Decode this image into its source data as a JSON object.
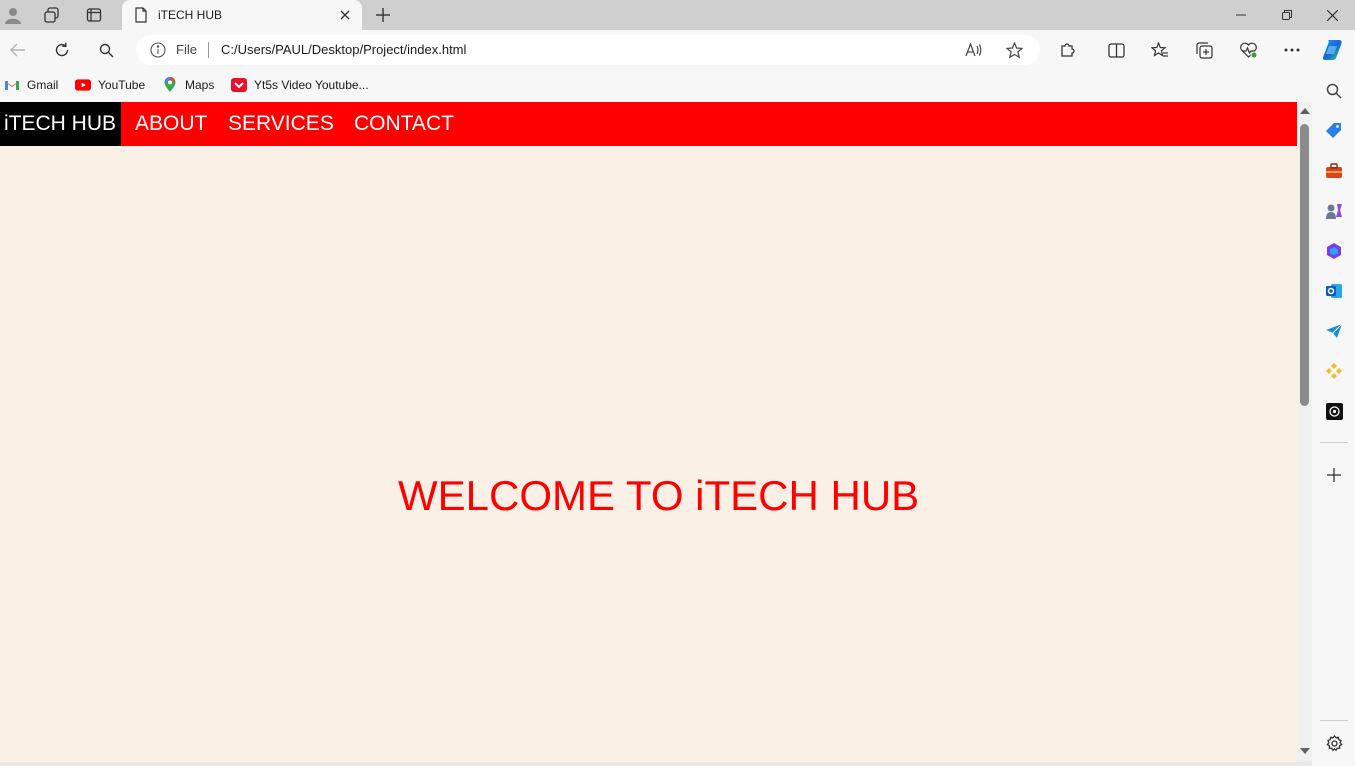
{
  "browser": {
    "tab_title": "iTECH HUB",
    "address": {
      "scheme_label": "File",
      "url": "C:/Users/PAUL/Desktop/Project/index.html"
    },
    "icons": {
      "profile": "profile-icon",
      "workspaces": "workspaces-icon",
      "tab_actions": "tab-actions-icon",
      "page": "page-icon",
      "close": "close-icon",
      "new_tab": "plus-icon",
      "minimize": "minimize-icon",
      "restore": "restore-icon",
      "window_close": "close-icon",
      "back": "back-arrow-icon",
      "refresh": "refresh-icon",
      "search": "search-icon",
      "info": "info-icon",
      "read_aloud": "read-aloud-icon",
      "favorite": "star-icon",
      "extensions": "puzzle-icon",
      "split_screen": "split-screen-icon",
      "favorites": "favorites-icon",
      "collections": "collections-icon",
      "browser_essentials": "heart-pulse-icon",
      "more": "more-icon",
      "copilot": "copilot-icon"
    },
    "bookmarks": [
      {
        "label": "Gmail",
        "icon": "gmail-icon"
      },
      {
        "label": "YouTube",
        "icon": "youtube-icon"
      },
      {
        "label": "Maps",
        "icon": "maps-pin-icon"
      },
      {
        "label": "Yt5s Video Youtube...",
        "icon": "yt5s-icon"
      }
    ],
    "sidebar_icons": [
      "search-icon",
      "tag-icon",
      "toolbox-icon",
      "games-icon",
      "office-icon",
      "outlook-icon",
      "send-icon",
      "binance-icon",
      "chatgpt-icon",
      "plus-icon",
      "settings-icon"
    ]
  },
  "site": {
    "colors": {
      "nav_bg": "#ff0000",
      "logo_bg": "#000000",
      "page_bg": "#faf0e6",
      "heading": "#ff0000"
    },
    "logo": "iTECH HUB",
    "nav_links": [
      "ABOUT",
      "SERVICES",
      "CONTACT"
    ],
    "heading": "WELCOME TO iTECH HUB"
  }
}
